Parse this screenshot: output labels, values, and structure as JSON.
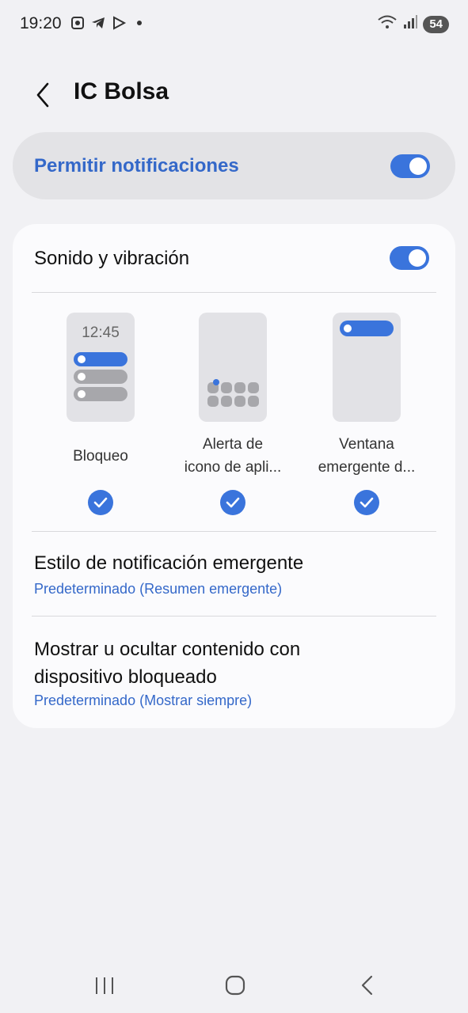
{
  "status_bar": {
    "time": "19:20",
    "battery": "54",
    "left_icons": [
      "screenshot-icon",
      "telegram-icon",
      "play-icon",
      "dot-icon"
    ],
    "right_icons": [
      "wifi-icon",
      "signal-icon"
    ]
  },
  "header": {
    "title": "IC Bolsa"
  },
  "master_toggle": {
    "label": "Permitir notificaciones",
    "on": true
  },
  "sound_vibration": {
    "label": "Sonido y vibración",
    "on": true
  },
  "notification_types": [
    {
      "label": "Bloqueo",
      "clock": "12:45",
      "checked": true
    },
    {
      "label_line1": "Alerta de",
      "label_line2": "icono de apli...",
      "checked": true
    },
    {
      "label_line1": "Ventana",
      "label_line2": "emergente d...",
      "checked": true
    }
  ],
  "popup_style": {
    "title": "Estilo de notificación emergente",
    "value": "Predeterminado (Resumen emergente)"
  },
  "lock_content": {
    "title_line1": "Mostrar u ocultar contenido con",
    "title_line2": "dispositivo bloqueado",
    "value": "Predeterminado (Mostrar siempre)"
  },
  "colors": {
    "accent": "#3a74dc",
    "accent_text": "#3468c9",
    "background": "#f1f1f4",
    "card": "#fbfbfd"
  }
}
